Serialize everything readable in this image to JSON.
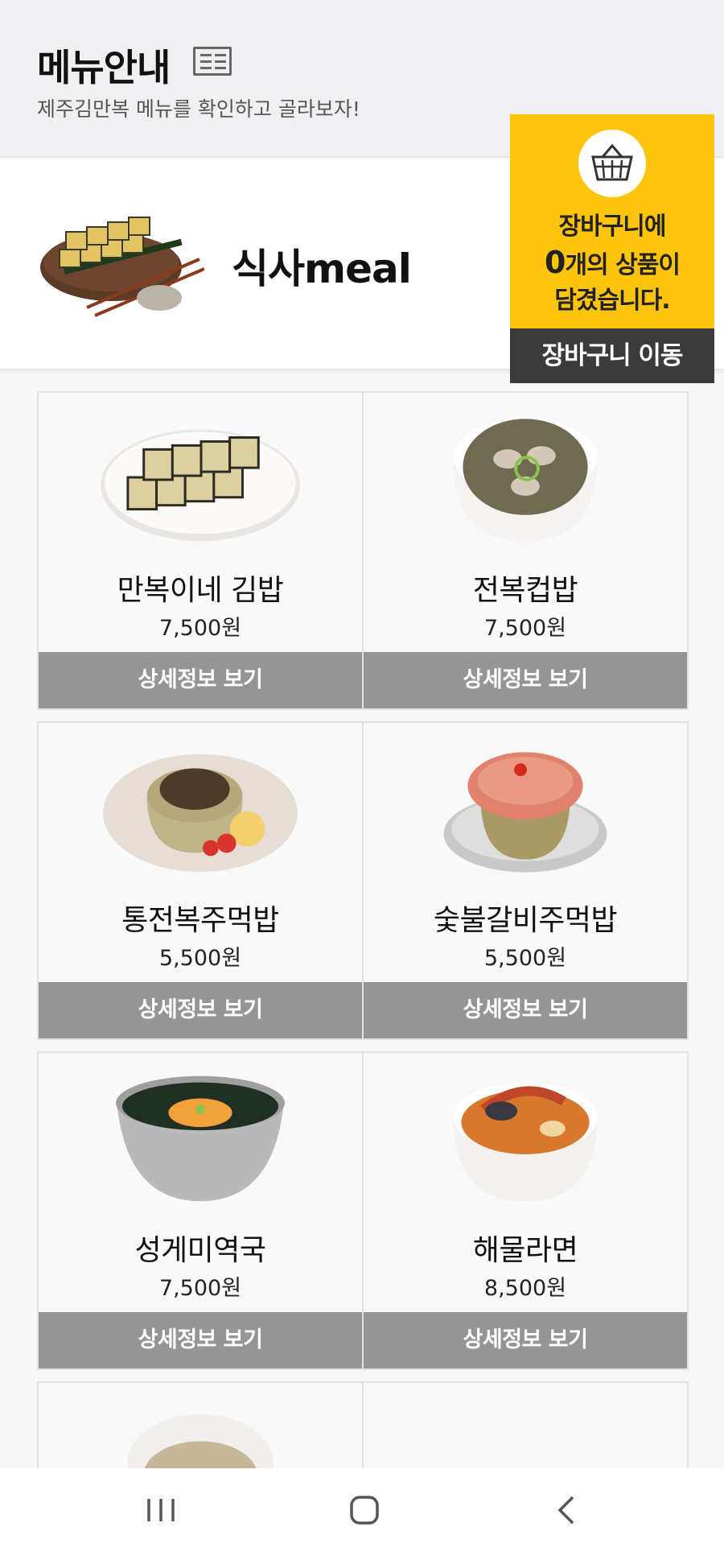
{
  "header": {
    "title": "메뉴안내",
    "subtitle": "제주김만복 메뉴를 확인하고 골라보자!"
  },
  "category": {
    "title": "식사meal"
  },
  "cart": {
    "line1": "장바구니에",
    "count": "0",
    "line2": "개의 상품이",
    "line3": "담겼습니다.",
    "button_label": "장바구니 이동",
    "accent_color": "#fcc40b"
  },
  "menu_items": [
    {
      "name": "만복이네 김밥",
      "price": "7,500원",
      "button_label": "상세정보 보기"
    },
    {
      "name": "전복컵밥",
      "price": "7,500원",
      "button_label": "상세정보 보기"
    },
    {
      "name": "통전복주먹밥",
      "price": "5,500원",
      "button_label": "상세정보 보기"
    },
    {
      "name": "숯불갈비주먹밥",
      "price": "5,500원",
      "button_label": "상세정보 보기"
    },
    {
      "name": "성게미역국",
      "price": "7,500원",
      "button_label": "상세정보 보기"
    },
    {
      "name": "해물라면",
      "price": "8,500원",
      "button_label": "상세정보 보기"
    }
  ],
  "navbar": {
    "icons": [
      "recent-apps-icon",
      "home-icon",
      "back-icon"
    ]
  }
}
